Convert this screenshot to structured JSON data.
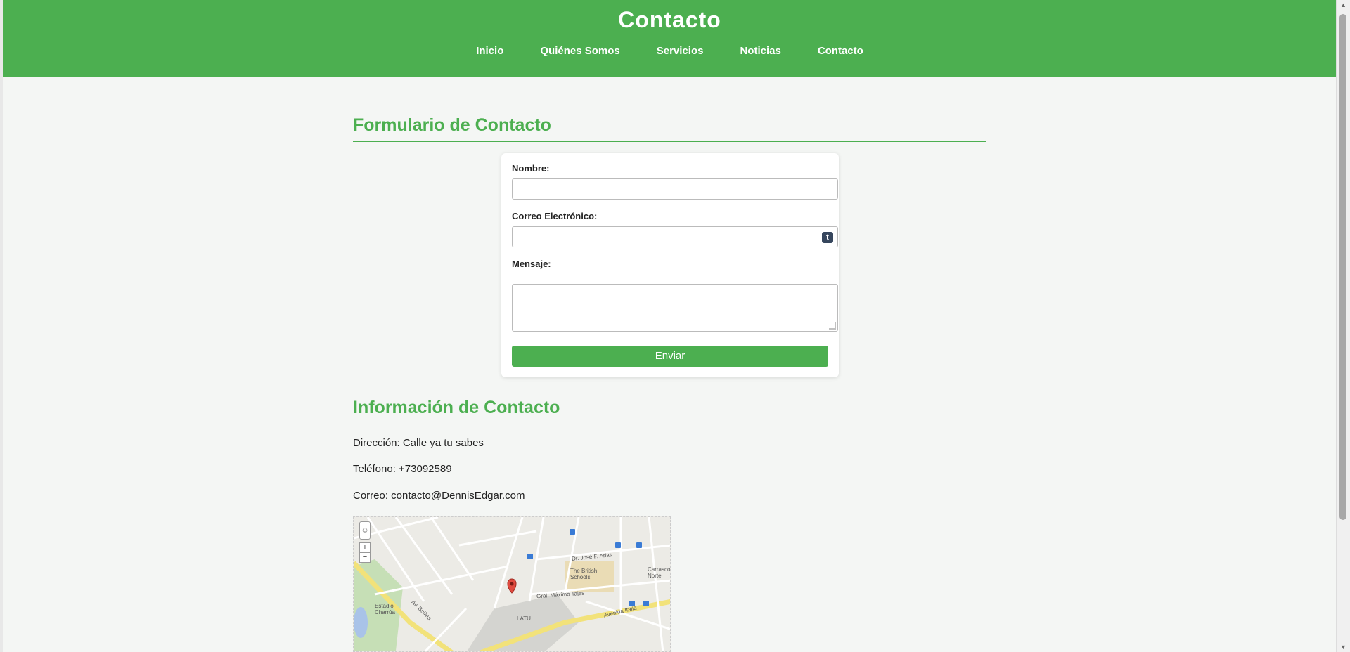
{
  "header": {
    "title": "Contacto",
    "nav": [
      "Inicio",
      "Quiénes Somos",
      "Servicios",
      "Noticias",
      "Contacto"
    ]
  },
  "form_section": {
    "title": "Formulario de Contacto",
    "name_label": "Nombre:",
    "email_label": "Correo Electrónico:",
    "message_label": "Mensaje:",
    "submit_label": "Enviar",
    "autofill_badge": "t"
  },
  "info_section": {
    "title": "Información de Contacto",
    "address": "Dirección: Calle ya tu sabes",
    "phone": "Teléfono: +73092589",
    "email": "Correo: contacto@DennisEdgar.com"
  },
  "map": {
    "zoom_in": "+",
    "zoom_out": "−",
    "labels": {
      "british_schools": "The British Schools",
      "estadio": "Estadio Charrúa",
      "latu": "LATU",
      "avenida_italia": "Avenida Italia",
      "carrasco_norte": "Carrasco Norte",
      "gral_maximo_tajes": "Gral. Máximo Tajes",
      "av_bolivia": "Av. Bolivia",
      "dr_jose_arias": "Dr. José F. Arias"
    }
  },
  "colors": {
    "accent": "#4caf50",
    "background": "#f4f6f4"
  }
}
